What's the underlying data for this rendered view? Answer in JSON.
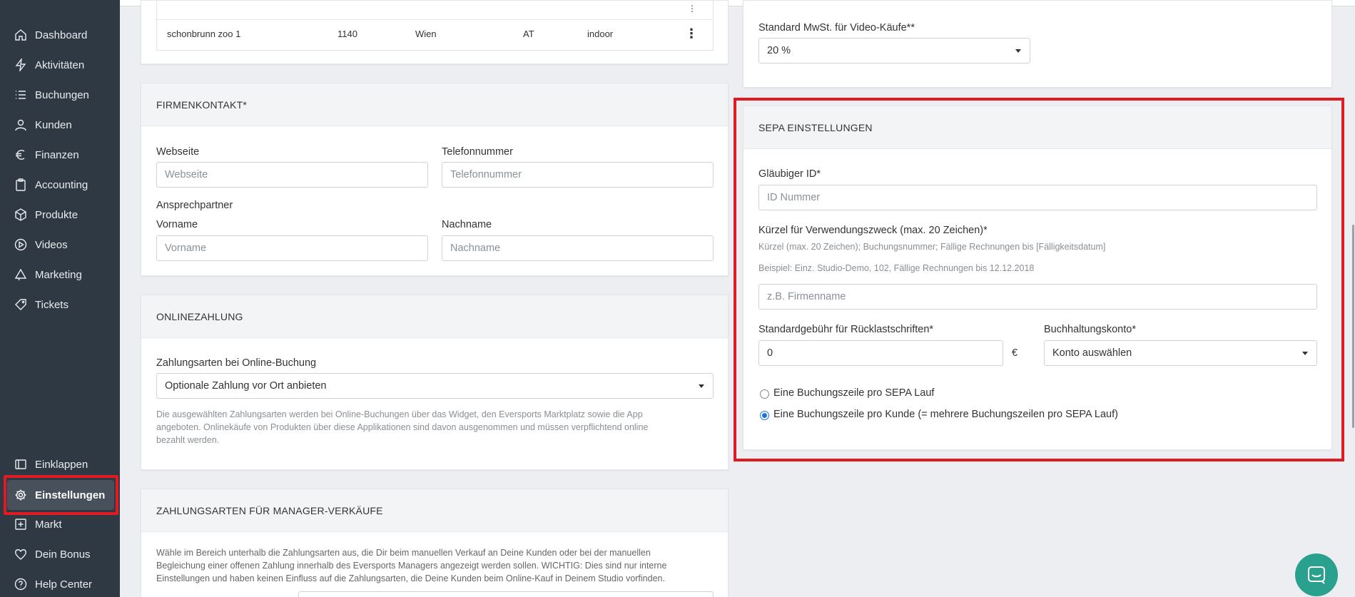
{
  "sidebar": {
    "items": [
      {
        "label": "Dashboard",
        "icon": "home-icon"
      },
      {
        "label": "Aktivitäten",
        "icon": "activity-icon"
      },
      {
        "label": "Buchungen",
        "icon": "list-icon"
      },
      {
        "label": "Kunden",
        "icon": "user-icon"
      },
      {
        "label": "Finanzen",
        "icon": "euro-icon"
      },
      {
        "label": "Accounting",
        "icon": "clipboard-icon"
      },
      {
        "label": "Produkte",
        "icon": "box-icon"
      },
      {
        "label": "Videos",
        "icon": "play-icon"
      },
      {
        "label": "Marketing",
        "icon": "megaphone-icon"
      },
      {
        "label": "Tickets",
        "icon": "tag-icon"
      }
    ],
    "bottom": [
      {
        "label": "Einklappen",
        "icon": "collapse-icon"
      },
      {
        "label": "Einstellungen",
        "icon": "gear-icon",
        "active": true
      },
      {
        "label": "Markt",
        "icon": "plus-square-icon"
      },
      {
        "label": "Dein Bonus",
        "icon": "heart-icon"
      },
      {
        "label": "Help Center",
        "icon": "help-icon"
      }
    ]
  },
  "locations": {
    "row": {
      "name": "schonbrunn zoo 1",
      "zip": "1140",
      "city": "Wien",
      "country": "AT",
      "type": "indoor"
    }
  },
  "firmenkontakt": {
    "title": "FIRMENKONTAKT*",
    "website_label": "Webseite",
    "website_placeholder": "Webseite",
    "phone_label": "Telefonnummer",
    "phone_placeholder": "Telefonnummer",
    "contact_label": "Ansprechpartner",
    "firstname_label": "Vorname",
    "firstname_placeholder": "Vorname",
    "lastname_label": "Nachname",
    "lastname_placeholder": "Nachname"
  },
  "onlinezahlung": {
    "title": "ONLINEZAHLUNG",
    "label": "Zahlungsarten bei Online-Buchung",
    "selected": "Optionale Zahlung vor Ort anbieten",
    "help_lines": [
      "Die ausgewählten Zahlungsarten werden bei Online-Buchungen über das Widget, den Eversports Marktplatz sowie die App",
      "angeboten. Onlinekäufe von Produkten über diese Applikationen sind davon ausgenommen und müssen verpflichtend online",
      "bezahlt werden."
    ]
  },
  "manager": {
    "title": "ZAHLUNGSARTEN FÜR MANAGER-VERKÄUFE",
    "help_lines": [
      "Wähle im Bereich unterhalb die Zahlungsarten aus, die Dir beim manuellen Verkauf an Deine Kunden oder bei der manuellen",
      "Begleichung einer offenen Zahlung innerhalb des Eversports Managers angezeigt werden sollen. WICHTIG: Dies sind nur interne",
      "Einstellungen und haben keinen Einfluss auf die Zahlungsarten, die Deine Kunden beim Online-Kauf in Deinem Studio vorfinden."
    ]
  },
  "vat": {
    "label": "Standard MwSt. für Video-Käufe**",
    "selected": "20 %"
  },
  "sepa": {
    "title": "SEPA EINSTELLUNGEN",
    "creditor_label": "Gläubiger ID*",
    "creditor_placeholder": "ID Nummer",
    "purpose_label": "Kürzel für Verwendungszweck (max. 20 Zeichen)*",
    "purpose_help1": "Kürzel (max. 20 Zeichen); Buchungsnummer; Fällige Rechnungen bis [Fälligkeitsdatum]",
    "purpose_help2": "Beispiel: Einz. Studio-Demo, 102, Fällige Rechnungen bis 12.12.2018",
    "purpose_placeholder": "z.B. Firmenname",
    "fee_label": "Standardgebühr für Rücklastschriften*",
    "fee_value": "0",
    "currency": "€",
    "account_label": "Buchhaltungskonto*",
    "account_selected": "Konto auswählen",
    "option1": "Eine Buchungszeile pro SEPA Lauf",
    "option2": "Eine Buchungszeile pro Kunde (= mehrere Buchungszeilen pro SEPA Lauf)"
  }
}
